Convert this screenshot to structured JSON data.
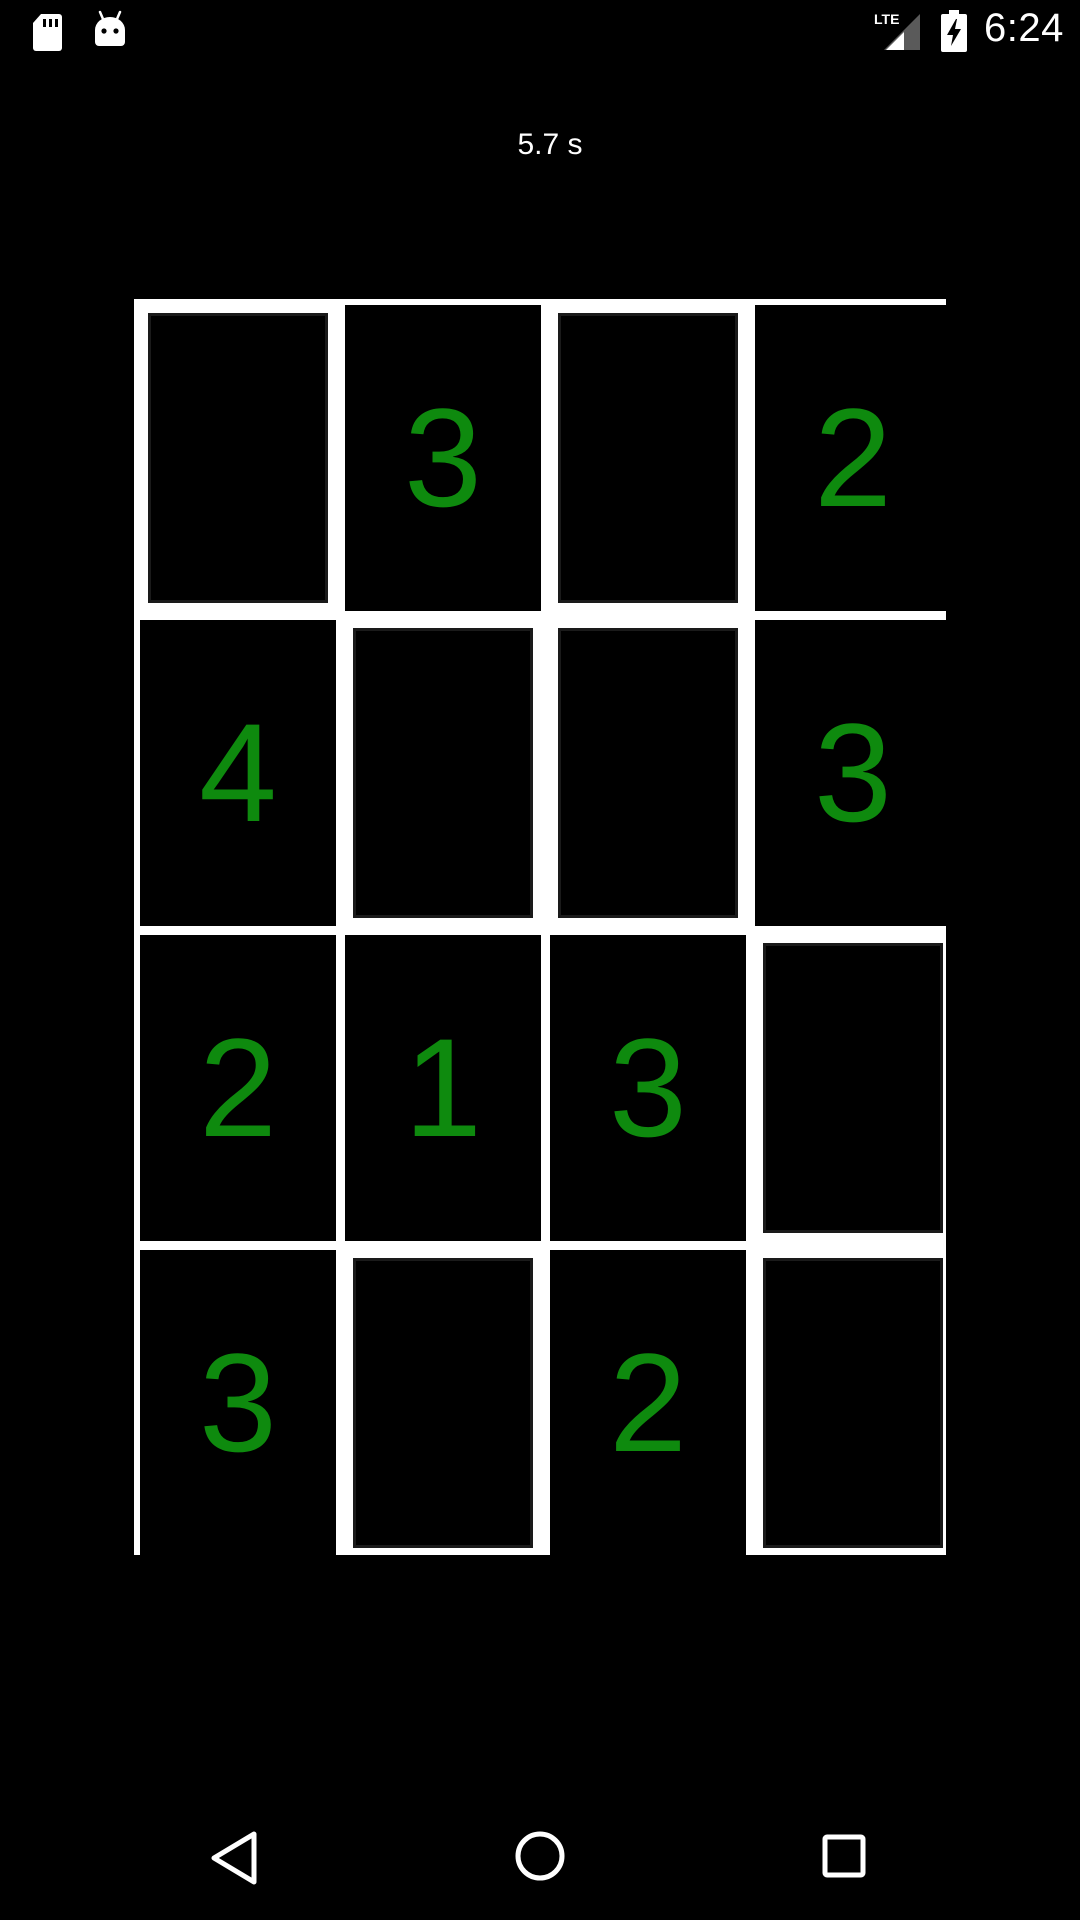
{
  "status_bar": {
    "time": "6:24",
    "network": "LTE",
    "icons": [
      "sd-card-icon",
      "android-debug-icon",
      "lte-signal-icon",
      "battery-charging-icon"
    ]
  },
  "timer": "5.7 s",
  "board": {
    "rows": 4,
    "cols": 4,
    "cells": [
      {
        "value": "",
        "raised": false
      },
      {
        "value": "3",
        "raised": true
      },
      {
        "value": "",
        "raised": false
      },
      {
        "value": "2",
        "raised": true
      },
      {
        "value": "4",
        "raised": true
      },
      {
        "value": "",
        "raised": false
      },
      {
        "value": "",
        "raised": false
      },
      {
        "value": "3",
        "raised": true
      },
      {
        "value": "2",
        "raised": true
      },
      {
        "value": "1",
        "raised": true
      },
      {
        "value": "3",
        "raised": true
      },
      {
        "value": "",
        "raised": false
      },
      {
        "value": "3",
        "raised": true
      },
      {
        "value": "",
        "raised": false
      },
      {
        "value": "2",
        "raised": true
      },
      {
        "value": "",
        "raised": false
      }
    ],
    "number_color": "#0e8a0e",
    "grid_color": "#ffffff",
    "background": "#000000"
  },
  "nav_bar": {
    "buttons": [
      "back-icon",
      "home-icon",
      "recent-apps-icon"
    ]
  }
}
